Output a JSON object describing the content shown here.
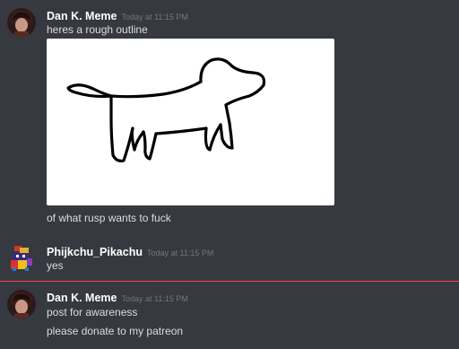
{
  "messages": [
    {
      "username": "Dan K. Meme",
      "timestamp": "Today at 11:15 PM",
      "avatar_icon": "dark-haired-avatar",
      "lines": [
        "heres a rough outline"
      ],
      "attachment": {
        "type": "image",
        "description_icon": "dog-sketch-drawing"
      },
      "after_attachment": [
        "of what rusp wants to fuck"
      ]
    },
    {
      "username": "Phijkchu_Pikachu",
      "timestamp": "Today at 11:15 PM",
      "avatar_icon": "pixel-art-avatar",
      "lines": [
        "yes"
      ]
    },
    {
      "username": "Dan K. Meme",
      "timestamp": "Today at 11:15 PM",
      "avatar_icon": "dark-haired-avatar",
      "lines": [
        "post for awareness",
        "please donate to my patreon"
      ]
    }
  ],
  "colors": {
    "background": "#36393f",
    "username": "#ffffff",
    "timestamp": "#72767d",
    "text": "#dcddde",
    "new_messages_divider": "#f04747"
  }
}
